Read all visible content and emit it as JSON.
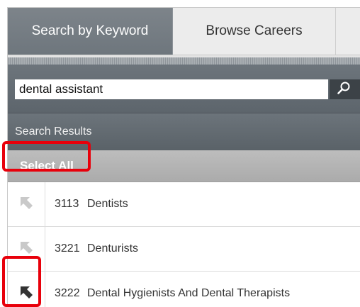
{
  "tabs": [
    {
      "label": "Search by Keyword",
      "active": true
    },
    {
      "label": "Browse Careers",
      "active": false
    }
  ],
  "search": {
    "value": "dental assistant",
    "button_icon": "magnifier-icon"
  },
  "results": {
    "header": "Search Results",
    "select_all_label": "Select All",
    "rows": [
      {
        "code": "3113",
        "title": "Dentists",
        "arrow_state": "inactive"
      },
      {
        "code": "3221",
        "title": "Denturists",
        "arrow_state": "inactive"
      },
      {
        "code": "3222",
        "title": "Dental Hygienists And Dental Therapists",
        "arrow_state": "active"
      }
    ]
  },
  "colors": {
    "tab_active_bg": "#737a81",
    "highlight": "#e8000b",
    "arrow_inactive": "#c9c9c9",
    "arrow_active": "#333333"
  }
}
